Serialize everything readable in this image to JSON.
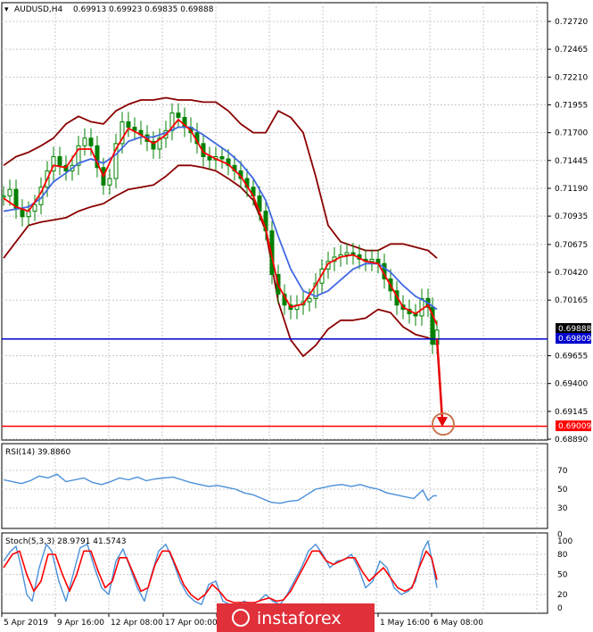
{
  "header": {
    "symbol": "AUDUSD,H4",
    "ohlc": "0.69913 0.69923 0.69835 0.69888"
  },
  "colors": {
    "background": "#ffffff",
    "grid": "#c8c8c8",
    "candle": "#008000",
    "bollinger": "#8b0000",
    "ma_fast": "#ff0000",
    "ma_slow": "#4169e1",
    "support_line": "#0000cd",
    "target_line": "#ff0000",
    "forecast_arrow": "#e60000",
    "target_circle": "#c87850",
    "rsi_line": "#4a90d9",
    "stoch_main": "#4a90d9",
    "stoch_signal": "#ff0000",
    "watermark_bg": "#e0303a"
  },
  "price_axis": {
    "ticks": [
      "0.72720",
      "0.72465",
      "0.72210",
      "0.71955",
      "0.71700",
      "0.71445",
      "0.71190",
      "0.70935",
      "0.70675",
      "0.70420",
      "0.70165",
      "0.69655",
      "0.69400",
      "0.69145",
      "0.68890"
    ],
    "current_price_label": "0.69888",
    "support_label": "0.69809",
    "target_label": "0.69009"
  },
  "time_axis": {
    "labels": [
      "5 Apr 2019",
      "9 Apr 16:00",
      "12 Apr 08:00",
      "17 Apr 00:00",
      "",
      "",
      "",
      "1 May 16:00",
      "6 May 08:00"
    ]
  },
  "rsi_panel": {
    "label": "RSI(14) 39.8860",
    "levels": [
      "70",
      "50",
      "30",
      "0"
    ]
  },
  "stoch_panel": {
    "label": "Stoch(5,3,3) 28.9791 41.5743",
    "levels": [
      "100",
      "80",
      "50",
      "20",
      "0"
    ]
  },
  "watermark": {
    "text": "instaforex"
  },
  "chart_data": {
    "type": "candlestick",
    "symbol": "AUDUSD",
    "timeframe": "H4",
    "price_range": [
      0.688,
      0.7285
    ],
    "key_levels": {
      "support": 0.69809,
      "target": 0.69009,
      "last": 0.69888
    },
    "price_path": [
      [
        0,
        0.7112
      ],
      [
        7,
        0.7118
      ],
      [
        14,
        0.71
      ],
      [
        21,
        0.7093
      ],
      [
        28,
        0.7098
      ],
      [
        35,
        0.7104
      ],
      [
        42,
        0.712
      ],
      [
        49,
        0.7135
      ],
      [
        56,
        0.7148
      ],
      [
        63,
        0.714
      ],
      [
        70,
        0.7135
      ],
      [
        77,
        0.714
      ],
      [
        84,
        0.7158
      ],
      [
        91,
        0.7165
      ],
      [
        98,
        0.7158
      ],
      [
        105,
        0.7138
      ],
      [
        112,
        0.7122
      ],
      [
        119,
        0.7128
      ],
      [
        126,
        0.716
      ],
      [
        133,
        0.718
      ],
      [
        140,
        0.7175
      ],
      [
        147,
        0.7172
      ],
      [
        154,
        0.7168
      ],
      [
        161,
        0.7162
      ],
      [
        168,
        0.7155
      ],
      [
        175,
        0.7165
      ],
      [
        182,
        0.7172
      ],
      [
        189,
        0.7188
      ],
      [
        196,
        0.7184
      ],
      [
        203,
        0.7175
      ],
      [
        210,
        0.717
      ],
      [
        217,
        0.716
      ],
      [
        224,
        0.7148
      ],
      [
        231,
        0.7145
      ],
      [
        238,
        0.7148
      ],
      [
        245,
        0.7146
      ],
      [
        252,
        0.714
      ],
      [
        259,
        0.7135
      ],
      [
        266,
        0.7128
      ],
      [
        273,
        0.712
      ],
      [
        280,
        0.7112
      ],
      [
        287,
        0.7098
      ],
      [
        294,
        0.708
      ],
      [
        301,
        0.704
      ],
      [
        308,
        0.7022
      ],
      [
        315,
        0.7012
      ],
      [
        322,
        0.7008
      ],
      [
        329,
        0.7012
      ],
      [
        336,
        0.7015
      ],
      [
        343,
        0.7018
      ],
      [
        350,
        0.7032
      ],
      [
        357,
        0.7045
      ],
      [
        364,
        0.7052
      ],
      [
        371,
        0.7056
      ],
      [
        378,
        0.7058
      ],
      [
        385,
        0.706
      ],
      [
        392,
        0.7058
      ],
      [
        399,
        0.7054
      ],
      [
        406,
        0.7052
      ],
      [
        413,
        0.7054
      ],
      [
        420,
        0.705
      ],
      [
        427,
        0.7036
      ],
      [
        434,
        0.7025
      ],
      [
        441,
        0.7012
      ],
      [
        448,
        0.7008
      ],
      [
        455,
        0.7004
      ],
      [
        462,
        0.7002
      ],
      [
        469,
        0.7018
      ],
      [
        476,
        0.701
      ],
      [
        481,
        0.6976
      ],
      [
        486,
        0.6989
      ]
    ],
    "bollinger_upper": [
      [
        0,
        0.714
      ],
      [
        14,
        0.7148
      ],
      [
        28,
        0.7152
      ],
      [
        42,
        0.7158
      ],
      [
        56,
        0.7165
      ],
      [
        70,
        0.7178
      ],
      [
        84,
        0.7185
      ],
      [
        98,
        0.718
      ],
      [
        112,
        0.7178
      ],
      [
        126,
        0.719
      ],
      [
        140,
        0.7196
      ],
      [
        154,
        0.72
      ],
      [
        168,
        0.72
      ],
      [
        182,
        0.7202
      ],
      [
        196,
        0.72
      ],
      [
        210,
        0.72
      ],
      [
        224,
        0.7198
      ],
      [
        238,
        0.7198
      ],
      [
        252,
        0.719
      ],
      [
        266,
        0.7178
      ],
      [
        280,
        0.717
      ],
      [
        294,
        0.717
      ],
      [
        308,
        0.719
      ],
      [
        322,
        0.7184
      ],
      [
        336,
        0.717
      ],
      [
        350,
        0.713
      ],
      [
        364,
        0.7085
      ],
      [
        378,
        0.707
      ],
      [
        392,
        0.7066
      ],
      [
        406,
        0.7062
      ],
      [
        420,
        0.7062
      ],
      [
        434,
        0.7068
      ],
      [
        448,
        0.7068
      ],
      [
        462,
        0.7065
      ],
      [
        476,
        0.7062
      ],
      [
        486,
        0.7055
      ]
    ],
    "bollinger_lower": [
      [
        0,
        0.7055
      ],
      [
        14,
        0.707
      ],
      [
        28,
        0.7085
      ],
      [
        42,
        0.7088
      ],
      [
        56,
        0.709
      ],
      [
        70,
        0.7092
      ],
      [
        84,
        0.7098
      ],
      [
        98,
        0.7102
      ],
      [
        112,
        0.7105
      ],
      [
        126,
        0.7112
      ],
      [
        140,
        0.7118
      ],
      [
        154,
        0.712
      ],
      [
        168,
        0.7122
      ],
      [
        182,
        0.713
      ],
      [
        196,
        0.714
      ],
      [
        210,
        0.714
      ],
      [
        224,
        0.7138
      ],
      [
        238,
        0.7135
      ],
      [
        252,
        0.7128
      ],
      [
        266,
        0.712
      ],
      [
        280,
        0.7108
      ],
      [
        294,
        0.708
      ],
      [
        308,
        0.7015
      ],
      [
        322,
        0.698
      ],
      [
        336,
        0.6965
      ],
      [
        350,
        0.6975
      ],
      [
        364,
        0.699
      ],
      [
        378,
        0.6998
      ],
      [
        392,
        0.6998
      ],
      [
        406,
        0.7
      ],
      [
        420,
        0.7008
      ],
      [
        434,
        0.7005
      ],
      [
        448,
        0.6992
      ],
      [
        462,
        0.6985
      ],
      [
        476,
        0.6982
      ],
      [
        486,
        0.6978
      ]
    ],
    "ma_fast": [
      [
        0,
        0.711
      ],
      [
        14,
        0.7102
      ],
      [
        28,
        0.7098
      ],
      [
        42,
        0.7115
      ],
      [
        56,
        0.714
      ],
      [
        70,
        0.7138
      ],
      [
        84,
        0.7155
      ],
      [
        98,
        0.7155
      ],
      [
        112,
        0.713
      ],
      [
        126,
        0.7155
      ],
      [
        140,
        0.7174
      ],
      [
        154,
        0.7168
      ],
      [
        168,
        0.716
      ],
      [
        182,
        0.7168
      ],
      [
        196,
        0.7182
      ],
      [
        210,
        0.7172
      ],
      [
        224,
        0.7152
      ],
      [
        238,
        0.7146
      ],
      [
        252,
        0.7141
      ],
      [
        266,
        0.713
      ],
      [
        280,
        0.7112
      ],
      [
        294,
        0.7082
      ],
      [
        308,
        0.703
      ],
      [
        322,
        0.701
      ],
      [
        336,
        0.7013
      ],
      [
        350,
        0.703
      ],
      [
        364,
        0.705
      ],
      [
        378,
        0.7056
      ],
      [
        392,
        0.7058
      ],
      [
        406,
        0.7052
      ],
      [
        420,
        0.705
      ],
      [
        434,
        0.703
      ],
      [
        448,
        0.701
      ],
      [
        462,
        0.7004
      ],
      [
        476,
        0.7012
      ],
      [
        486,
        0.6994
      ]
    ],
    "ma_slow": [
      [
        0,
        0.7098
      ],
      [
        14,
        0.71
      ],
      [
        28,
        0.7102
      ],
      [
        42,
        0.711
      ],
      [
        56,
        0.7125
      ],
      [
        70,
        0.7133
      ],
      [
        84,
        0.7142
      ],
      [
        98,
        0.7146
      ],
      [
        112,
        0.7142
      ],
      [
        126,
        0.715
      ],
      [
        140,
        0.7162
      ],
      [
        154,
        0.7166
      ],
      [
        168,
        0.7166
      ],
      [
        182,
        0.717
      ],
      [
        196,
        0.7175
      ],
      [
        210,
        0.7175
      ],
      [
        224,
        0.7168
      ],
      [
        238,
        0.716
      ],
      [
        252,
        0.7152
      ],
      [
        266,
        0.7142
      ],
      [
        280,
        0.7128
      ],
      [
        294,
        0.7108
      ],
      [
        308,
        0.7075
      ],
      [
        322,
        0.7045
      ],
      [
        336,
        0.7025
      ],
      [
        350,
        0.702
      ],
      [
        364,
        0.7025
      ],
      [
        378,
        0.7035
      ],
      [
        392,
        0.7045
      ],
      [
        406,
        0.705
      ],
      [
        420,
        0.705
      ],
      [
        434,
        0.7042
      ],
      [
        448,
        0.703
      ],
      [
        462,
        0.702
      ],
      [
        476,
        0.7014
      ],
      [
        486,
        0.7008
      ]
    ],
    "forecast_arrow": {
      "from": [
        486,
        0.6981
      ],
      "to": [
        492,
        0.6902
      ]
    },
    "rsi": [
      [
        0,
        60
      ],
      [
        10,
        58
      ],
      [
        20,
        56
      ],
      [
        30,
        59
      ],
      [
        40,
        64
      ],
      [
        50,
        62
      ],
      [
        60,
        66
      ],
      [
        70,
        58
      ],
      [
        80,
        60
      ],
      [
        90,
        62
      ],
      [
        100,
        57
      ],
      [
        110,
        55
      ],
      [
        120,
        58
      ],
      [
        130,
        62
      ],
      [
        140,
        60
      ],
      [
        150,
        63
      ],
      [
        160,
        59
      ],
      [
        170,
        61
      ],
      [
        180,
        62
      ],
      [
        190,
        63
      ],
      [
        200,
        60
      ],
      [
        210,
        57
      ],
      [
        220,
        55
      ],
      [
        230,
        53
      ],
      [
        240,
        54
      ],
      [
        250,
        52
      ],
      [
        260,
        50
      ],
      [
        270,
        46
      ],
      [
        280,
        44
      ],
      [
        290,
        40
      ],
      [
        300,
        36
      ],
      [
        310,
        35
      ],
      [
        320,
        37
      ],
      [
        330,
        38
      ],
      [
        340,
        44
      ],
      [
        350,
        50
      ],
      [
        360,
        52
      ],
      [
        370,
        54
      ],
      [
        380,
        55
      ],
      [
        390,
        53
      ],
      [
        400,
        55
      ],
      [
        410,
        52
      ],
      [
        420,
        50
      ],
      [
        430,
        46
      ],
      [
        440,
        44
      ],
      [
        450,
        42
      ],
      [
        460,
        40
      ],
      [
        470,
        49
      ],
      [
        476,
        38
      ],
      [
        482,
        43
      ],
      [
        486,
        43
      ]
    ],
    "stoch_main": [
      [
        0,
        70
      ],
      [
        8,
        85
      ],
      [
        14,
        92
      ],
      [
        20,
        60
      ],
      [
        26,
        20
      ],
      [
        32,
        10
      ],
      [
        40,
        60
      ],
      [
        48,
        95
      ],
      [
        54,
        85
      ],
      [
        62,
        40
      ],
      [
        70,
        10
      ],
      [
        78,
        50
      ],
      [
        86,
        90
      ],
      [
        94,
        95
      ],
      [
        102,
        60
      ],
      [
        110,
        30
      ],
      [
        118,
        20
      ],
      [
        126,
        70
      ],
      [
        134,
        88
      ],
      [
        142,
        60
      ],
      [
        150,
        30
      ],
      [
        158,
        10
      ],
      [
        166,
        50
      ],
      [
        174,
        85
      ],
      [
        182,
        95
      ],
      [
        190,
        70
      ],
      [
        198,
        40
      ],
      [
        206,
        20
      ],
      [
        214,
        10
      ],
      [
        222,
        5
      ],
      [
        230,
        35
      ],
      [
        238,
        40
      ],
      [
        246,
        10
      ],
      [
        254,
        5
      ],
      [
        262,
        5
      ],
      [
        270,
        10
      ],
      [
        278,
        5
      ],
      [
        286,
        10
      ],
      [
        294,
        20
      ],
      [
        302,
        10
      ],
      [
        310,
        5
      ],
      [
        318,
        20
      ],
      [
        326,
        40
      ],
      [
        334,
        60
      ],
      [
        342,
        85
      ],
      [
        350,
        95
      ],
      [
        358,
        80
      ],
      [
        366,
        60
      ],
      [
        374,
        70
      ],
      [
        382,
        72
      ],
      [
        390,
        80
      ],
      [
        398,
        60
      ],
      [
        406,
        30
      ],
      [
        414,
        40
      ],
      [
        422,
        70
      ],
      [
        430,
        60
      ],
      [
        438,
        30
      ],
      [
        446,
        20
      ],
      [
        454,
        25
      ],
      [
        462,
        40
      ],
      [
        470,
        85
      ],
      [
        476,
        100
      ],
      [
        482,
        60
      ],
      [
        486,
        30
      ]
    ],
    "stoch_signal": [
      [
        0,
        60
      ],
      [
        10,
        80
      ],
      [
        18,
        85
      ],
      [
        26,
        50
      ],
      [
        34,
        25
      ],
      [
        42,
        40
      ],
      [
        50,
        80
      ],
      [
        58,
        80
      ],
      [
        66,
        50
      ],
      [
        74,
        25
      ],
      [
        82,
        50
      ],
      [
        90,
        85
      ],
      [
        98,
        85
      ],
      [
        106,
        55
      ],
      [
        114,
        30
      ],
      [
        122,
        40
      ],
      [
        130,
        75
      ],
      [
        138,
        75
      ],
      [
        146,
        50
      ],
      [
        154,
        25
      ],
      [
        162,
        30
      ],
      [
        170,
        65
      ],
      [
        178,
        85
      ],
      [
        186,
        85
      ],
      [
        194,
        60
      ],
      [
        202,
        35
      ],
      [
        210,
        20
      ],
      [
        218,
        12
      ],
      [
        226,
        20
      ],
      [
        234,
        35
      ],
      [
        242,
        25
      ],
      [
        250,
        12
      ],
      [
        258,
        8
      ],
      [
        266,
        8
      ],
      [
        274,
        8
      ],
      [
        282,
        8
      ],
      [
        290,
        12
      ],
      [
        298,
        15
      ],
      [
        306,
        10
      ],
      [
        314,
        12
      ],
      [
        322,
        25
      ],
      [
        330,
        45
      ],
      [
        338,
        65
      ],
      [
        346,
        85
      ],
      [
        354,
        85
      ],
      [
        362,
        70
      ],
      [
        370,
        65
      ],
      [
        378,
        70
      ],
      [
        386,
        75
      ],
      [
        394,
        75
      ],
      [
        402,
        55
      ],
      [
        410,
        40
      ],
      [
        418,
        50
      ],
      [
        426,
        60
      ],
      [
        434,
        45
      ],
      [
        442,
        30
      ],
      [
        450,
        25
      ],
      [
        458,
        30
      ],
      [
        466,
        60
      ],
      [
        474,
        85
      ],
      [
        480,
        75
      ],
      [
        486,
        42
      ]
    ]
  }
}
